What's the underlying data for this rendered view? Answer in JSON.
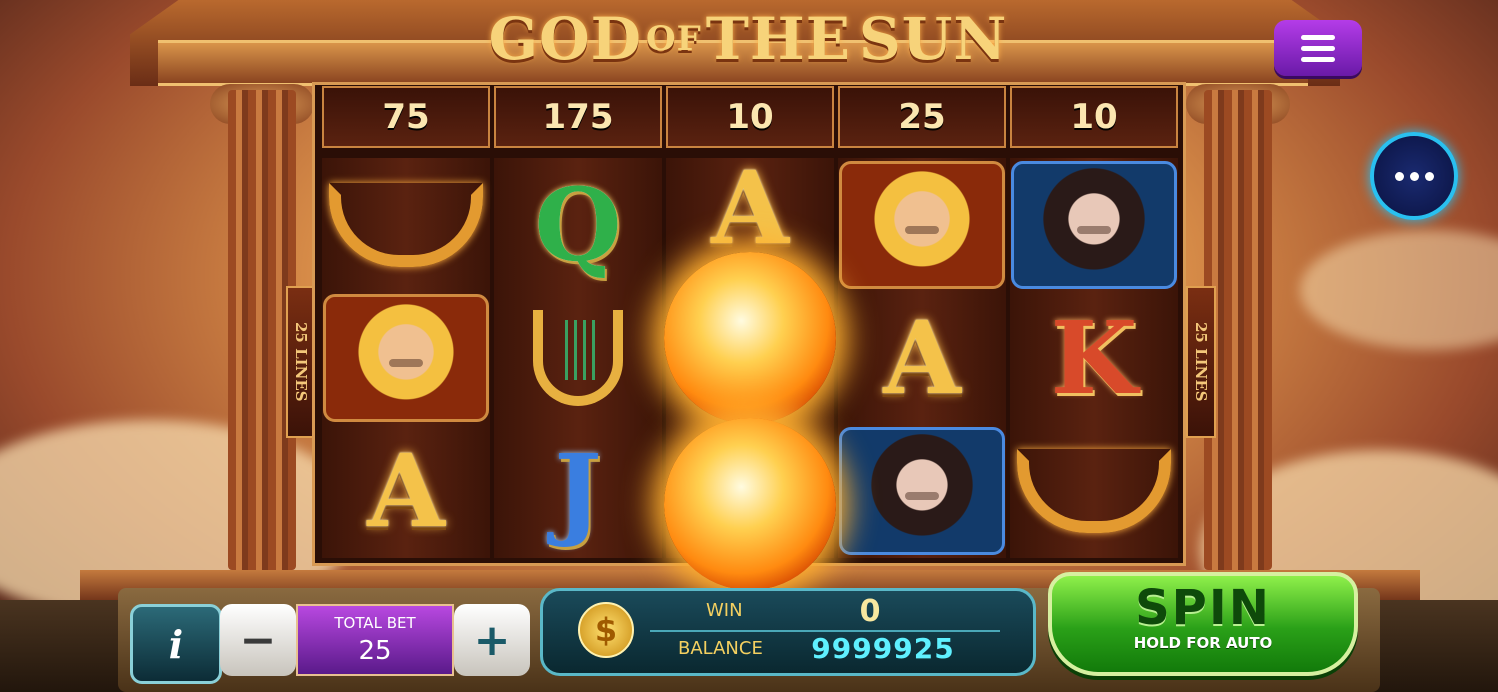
{
  "game": {
    "title_part1": "GOD",
    "title_part2": "OF",
    "title_part3": "THE",
    "title_part4": "SUN"
  },
  "paylines_label_left": "25 LINES",
  "paylines_label_right": "25 LINES",
  "payouts": [
    "75",
    "175",
    "10",
    "25",
    "10"
  ],
  "reels": [
    [
      {
        "type": "laurel-icon"
      },
      {
        "type": "apollo-icon"
      },
      {
        "type": "letter",
        "text": "A",
        "color": "gold"
      }
    ],
    [
      {
        "type": "letter",
        "text": "Q",
        "color": "green"
      },
      {
        "type": "lyre-icon"
      },
      {
        "type": "letter",
        "text": "J",
        "color": "blue"
      }
    ],
    [
      {
        "type": "letter",
        "text": "A",
        "color": "gold"
      },
      {
        "type": "sun-icon"
      },
      {
        "type": "sun-icon"
      }
    ],
    [
      {
        "type": "apollo-icon"
      },
      {
        "type": "letter",
        "text": "A",
        "color": "gold"
      },
      {
        "type": "goddess-icon"
      }
    ],
    [
      {
        "type": "goddess-icon"
      },
      {
        "type": "letter",
        "text": "K",
        "color": "red"
      },
      {
        "type": "laurel-icon"
      }
    ]
  ],
  "controls": {
    "info_label": "i",
    "minus_label": "−",
    "plus_label": "+",
    "total_bet_label": "TOTAL BET",
    "total_bet_value": "25",
    "coin_symbol": "$",
    "win_label": "WIN",
    "win_value": "0",
    "balance_label": "BALANCE",
    "balance_value": "9999925",
    "spin_label": "SPIN",
    "spin_sub_label": "HOLD FOR AUTO"
  },
  "colors": {
    "gold": "#f4c24a",
    "spin_green": "#2aa018",
    "balance_cyan": "#5ff0ff",
    "menu_purple": "#8a2ad0"
  }
}
